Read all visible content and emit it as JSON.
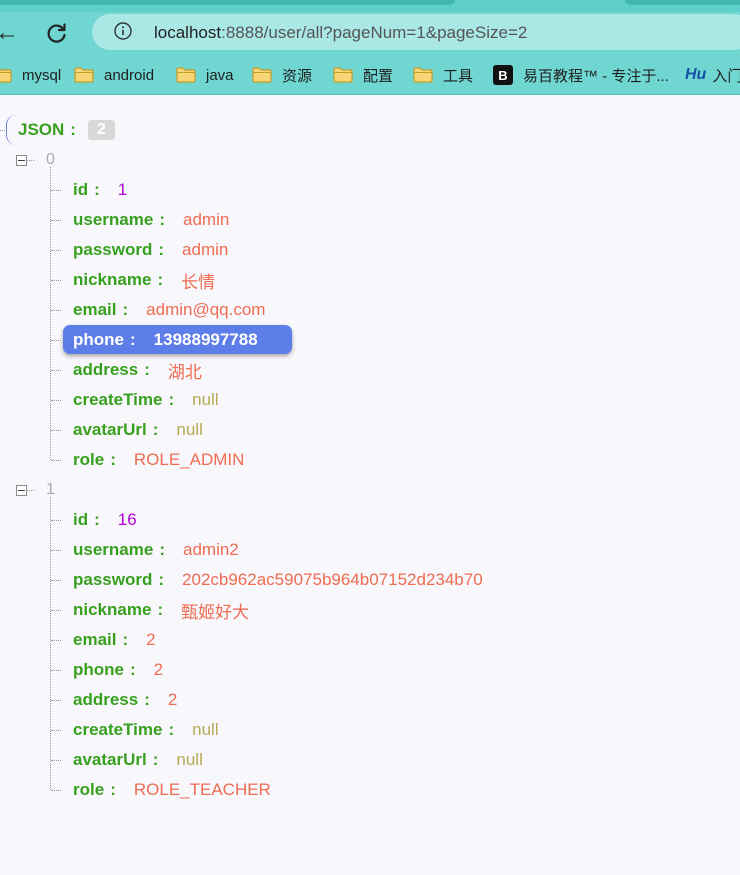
{
  "browser": {
    "url_host": "localhost",
    "url_rest": ":8888/user/all?pageNum=1&pageSize=2",
    "bookmarks": [
      {
        "label": "mysql",
        "icon": "folder-icon"
      },
      {
        "label": "android",
        "icon": "folder-icon"
      },
      {
        "label": "java",
        "icon": "folder-icon"
      },
      {
        "label": "资源",
        "icon": "folder-icon"
      },
      {
        "label": "配置",
        "icon": "folder-icon"
      },
      {
        "label": "工具",
        "icon": "folder-icon"
      },
      {
        "label": "易百教程™ - 专注于...",
        "icon": "b-logo-icon",
        "badge": "B"
      },
      {
        "label": "入门",
        "icon": "hu-logo-icon",
        "badge": "Hu"
      }
    ]
  },
  "json_view": {
    "root_label": "JSON",
    "root_count": "2",
    "items": [
      {
        "index": "0",
        "fields": [
          {
            "key": "id",
            "value": "1",
            "kind": "number"
          },
          {
            "key": "username",
            "value": "admin",
            "kind": "string"
          },
          {
            "key": "password",
            "value": "admin",
            "kind": "string"
          },
          {
            "key": "nickname",
            "value": "长情",
            "kind": "string"
          },
          {
            "key": "email",
            "value": "admin@qq.com",
            "kind": "string"
          },
          {
            "key": "phone",
            "value": "13988997788",
            "kind": "string",
            "selected": true
          },
          {
            "key": "address",
            "value": "湖北",
            "kind": "string"
          },
          {
            "key": "createTime",
            "value": "null",
            "kind": "null"
          },
          {
            "key": "avatarUrl",
            "value": "null",
            "kind": "null"
          },
          {
            "key": "role",
            "value": "ROLE_ADMIN",
            "kind": "string"
          }
        ]
      },
      {
        "index": "1",
        "fields": [
          {
            "key": "id",
            "value": "16",
            "kind": "number"
          },
          {
            "key": "username",
            "value": "admin2",
            "kind": "string"
          },
          {
            "key": "password",
            "value": "202cb962ac59075b964b07152d234b70",
            "kind": "string"
          },
          {
            "key": "nickname",
            "value": "甄姬好大",
            "kind": "string"
          },
          {
            "key": "email",
            "value": "2",
            "kind": "string"
          },
          {
            "key": "phone",
            "value": "2",
            "kind": "string"
          },
          {
            "key": "address",
            "value": "2",
            "kind": "string"
          },
          {
            "key": "createTime",
            "value": "null",
            "kind": "null"
          },
          {
            "key": "avatarUrl",
            "value": "null",
            "kind": "null"
          },
          {
            "key": "role",
            "value": "ROLE_TEACHER",
            "kind": "string"
          }
        ]
      }
    ]
  },
  "colors": {
    "key": "#37a01f",
    "string": "#ee6c52",
    "number": "#b000d8",
    "null": "#b5aa54",
    "selection": "#5d7de8",
    "chrome": "#6fd6d1"
  }
}
